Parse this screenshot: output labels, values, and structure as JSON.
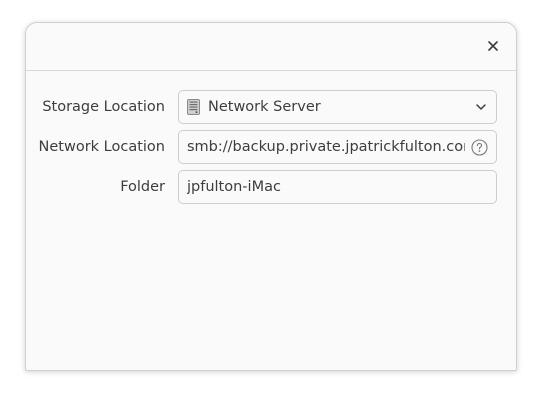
{
  "dialog": {
    "close_icon": "close-icon"
  },
  "storage_location": {
    "label": "Storage Location",
    "value": "Network Server",
    "icon": "network-drive-icon"
  },
  "network_location": {
    "label": "Network Location",
    "value": "smb://backup.private.jpatrickfulton.com/",
    "help_icon": "help-icon"
  },
  "folder": {
    "label": "Folder",
    "value": "jpfulton-iMac"
  }
}
